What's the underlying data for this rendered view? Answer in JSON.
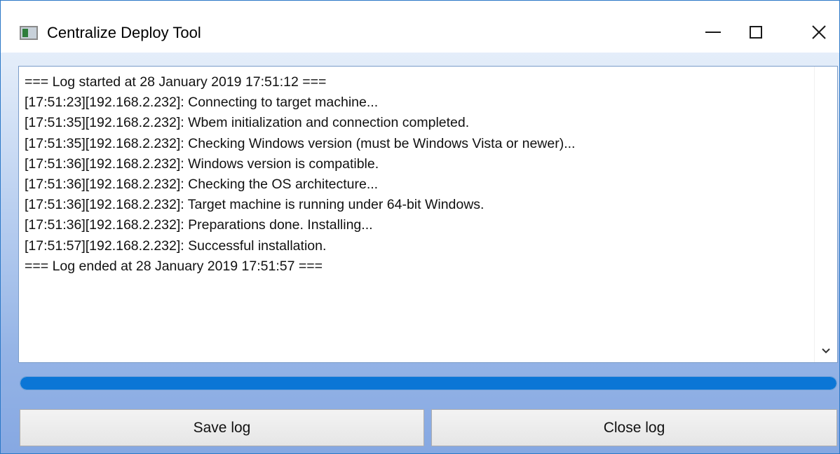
{
  "window": {
    "title": "Centralize Deploy Tool",
    "accent_color": "#0b76d6"
  },
  "titlebar_icons": {
    "minimize": "minimize-icon",
    "maximize": "maximize-icon",
    "close": "close-icon"
  },
  "log": {
    "lines": [
      "=== Log started at 28 January 2019 17:51:12 ===",
      "[17:51:23][192.168.2.232]: Connecting to target machine...",
      "[17:51:35][192.168.2.232]: Wbem initialization and connection completed.",
      "[17:51:35][192.168.2.232]: Checking Windows version (must be Windows Vista or newer)...",
      "[17:51:36][192.168.2.232]: Windows version is compatible.",
      "[17:51:36][192.168.2.232]: Checking the OS architecture...",
      "[17:51:36][192.168.2.232]: Target machine is running under 64-bit Windows.",
      "[17:51:36][192.168.2.232]: Preparations done. Installing...",
      "[17:51:57][192.168.2.232]: Successful installation.",
      "=== Log ended at 28 January 2019 17:51:57 ==="
    ]
  },
  "progress": {
    "percent": 100
  },
  "buttons": {
    "save_label": "Save log",
    "close_label": "Close log"
  }
}
